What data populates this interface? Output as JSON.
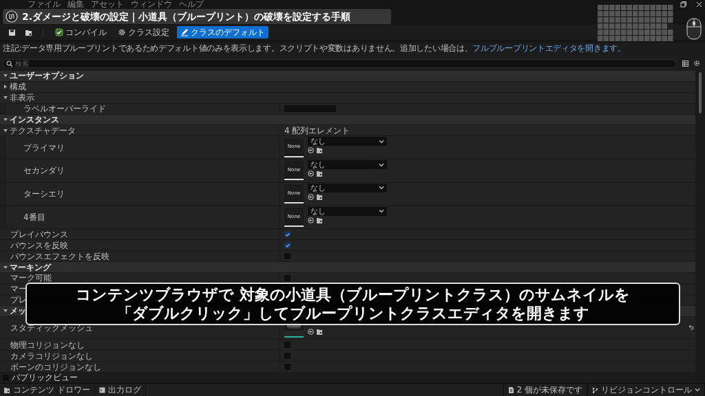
{
  "menu": [
    "ファイル",
    "編集",
    "アセット",
    "ウィンドウ",
    "ヘルプ"
  ],
  "banner": {
    "title": "2.ダメージと破壊の設定｜小道具（ブループリント）の破壊を設定する手順"
  },
  "toolbar": [
    {
      "kind": "save"
    },
    {
      "kind": "browse"
    },
    {
      "kind": "compile",
      "label": "コンパイル",
      "selected": false
    },
    {
      "kind": "settings",
      "label": "クラス設定",
      "selected": false
    },
    {
      "kind": "defaults",
      "label": "クラスのデフォルト",
      "selected": true
    }
  ],
  "notice": {
    "text": "注記:データ専用ブループリントであるためデフォルト値のみを表示します。スクリプトや変数はありません。追加したい場合は、",
    "link": "フルブループリントエディタを開きます。"
  },
  "search": {
    "placeholder": "検索"
  },
  "details": [
    {
      "kind": "category",
      "label": "ユーザーオプション",
      "expanded": true,
      "children": [
        {
          "kind": "group",
          "label": "構成",
          "expanded": false
        },
        {
          "kind": "group",
          "label": "非表示",
          "expanded": true,
          "children": [
            {
              "kind": "field",
              "label": "ラベルオーバーライド"
            }
          ]
        }
      ]
    },
    {
      "kind": "category",
      "label": "インスタンス",
      "expanded": true,
      "children": [
        {
          "kind": "group",
          "label": "テクスチャデータ",
          "value": "4 配列エレメント",
          "expanded": true,
          "children": [
            {
              "kind": "texture",
              "label": "プライマリ",
              "thumb": "None",
              "value": "なし"
            },
            {
              "kind": "texture",
              "label": "セカンダリ",
              "thumb": "None",
              "value": "なし"
            },
            {
              "kind": "texture",
              "label": "ターシエリ",
              "thumb": "None",
              "value": "なし"
            },
            {
              "kind": "texture",
              "label": "4番目",
              "thumb": "None",
              "value": "なし"
            }
          ]
        },
        {
          "kind": "checkbox",
          "label": "プレイバウンス",
          "checked": true
        },
        {
          "kind": "checkbox",
          "label": "バウンスを反映",
          "checked": true
        },
        {
          "kind": "checkbox",
          "label": "バウンスエフェクトを反映",
          "checked": false
        }
      ]
    },
    {
      "kind": "category",
      "label": "マーキング",
      "expanded": true,
      "children": [
        {
          "kind": "checkbox",
          "label": "マーク可能",
          "checked": false
        },
        {
          "kind": "text",
          "label": "マー"
        },
        {
          "kind": "text",
          "label": "プレ"
        }
      ]
    },
    {
      "kind": "category",
      "label": "メッ",
      "expanded": true,
      "children": [
        {
          "kind": "mesh",
          "label": "スタティックメッシュ"
        },
        {
          "kind": "checkbox",
          "label": "物理コリジョンなし",
          "checked": false
        },
        {
          "kind": "checkbox",
          "label": "カメラコリジョンなし",
          "checked": false
        },
        {
          "kind": "checkbox",
          "label": "ボーンのコリジョンなし",
          "checked": false
        }
      ]
    }
  ],
  "public_view": {
    "label": "パブリックビュー",
    "checked": false
  },
  "caption": [
    "コンテンツブラウザで 対象の小道具（ブループリントクラス）のサムネイルを",
    "「ダブルクリック」してブループリントクラスエディタを開きます"
  ],
  "status_left": [
    {
      "kind": "drawer",
      "label": "コンテンツ ドロワー"
    },
    {
      "kind": "log",
      "label": "出力ログ"
    }
  ],
  "status_right": [
    {
      "kind": "unsaved",
      "label": "2 個が未保存です"
    },
    {
      "kind": "revision",
      "label": "リビジョンコントロール"
    }
  ]
}
